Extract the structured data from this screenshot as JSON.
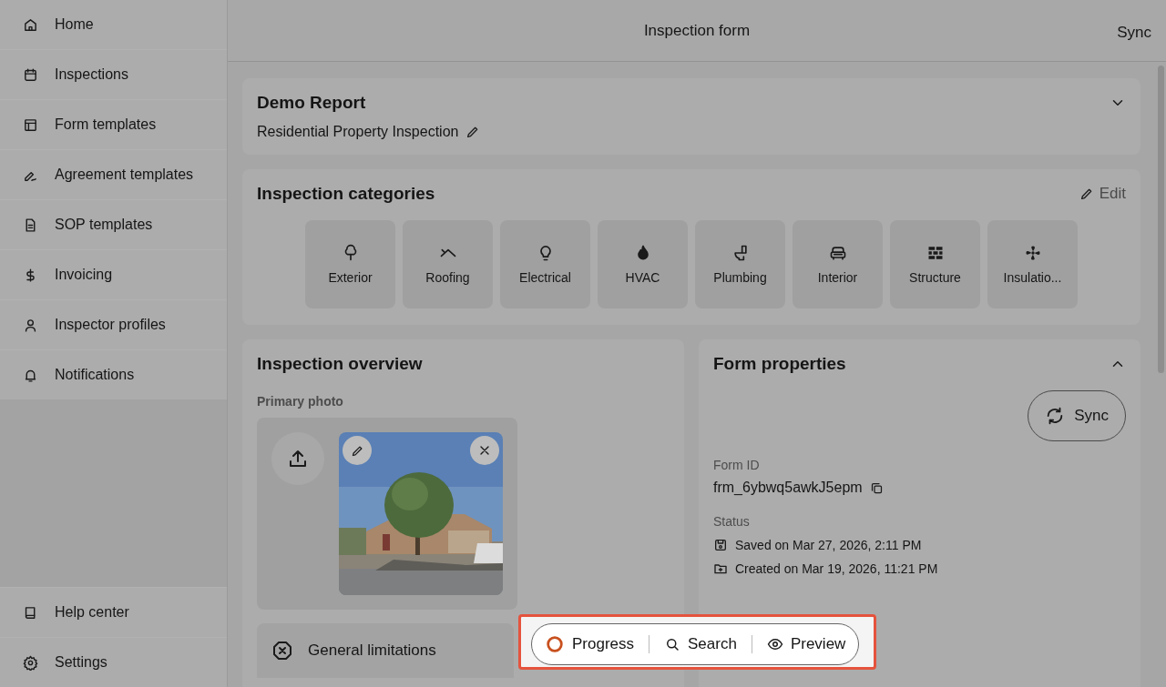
{
  "sidebar": {
    "items": [
      {
        "label": "Home"
      },
      {
        "label": "Inspections"
      },
      {
        "label": "Form templates"
      },
      {
        "label": "Agreement templates"
      },
      {
        "label": "SOP templates"
      },
      {
        "label": "Invoicing"
      },
      {
        "label": "Inspector profiles"
      },
      {
        "label": "Notifications"
      }
    ],
    "footer_items": [
      {
        "label": "Help center"
      },
      {
        "label": "Settings"
      }
    ]
  },
  "header": {
    "title": "Inspection form",
    "action": "Sync"
  },
  "report": {
    "title": "Demo Report",
    "subtitle": "Residential Property Inspection"
  },
  "categories": {
    "title": "Inspection categories",
    "edit": "Edit",
    "items": [
      {
        "label": "Exterior"
      },
      {
        "label": "Roofing"
      },
      {
        "label": "Electrical"
      },
      {
        "label": "HVAC"
      },
      {
        "label": "Plumbing"
      },
      {
        "label": "Interior"
      },
      {
        "label": "Structure"
      },
      {
        "label": "Insulatio..."
      }
    ]
  },
  "overview": {
    "title": "Inspection overview",
    "photo_label": "Primary photo",
    "limitations": "General limitations"
  },
  "properties": {
    "title": "Form properties",
    "sync": "Sync",
    "form_id_label": "Form ID",
    "form_id": "frm_6ybwq5awkJ5epm",
    "status_label": "Status",
    "status": [
      {
        "kind": "saved",
        "text": "Saved on Mar 27, 2026, 2:11 PM"
      },
      {
        "kind": "created",
        "text": "Created on Mar 19, 2026, 11:21 PM"
      }
    ]
  },
  "toolbar": {
    "items": [
      {
        "kind": "progress",
        "label": "Progress"
      },
      {
        "kind": "search",
        "label": "Search"
      },
      {
        "kind": "preview",
        "label": "Preview"
      }
    ]
  }
}
